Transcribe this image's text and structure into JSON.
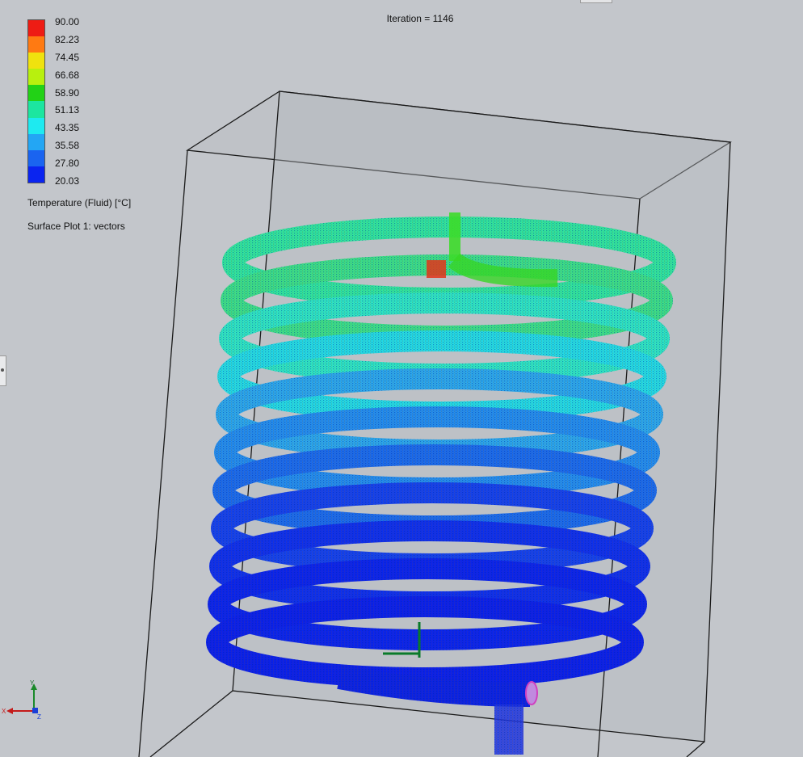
{
  "viewport": {
    "name": "3D graphics area"
  },
  "iteration_label": "Iteration = 1146",
  "legend": {
    "title": "Temperature (Fluid) [°C]",
    "plot_name": "Surface Plot 1: vectors",
    "ticks": [
      "90.00",
      "82.23",
      "74.45",
      "66.68",
      "58.90",
      "51.13",
      "43.35",
      "35.58",
      "27.80",
      "20.03"
    ],
    "colors": [
      "#ee1c14",
      "#ff7a12",
      "#f0e20e",
      "#b8f00e",
      "#22d216",
      "#1ce6a0",
      "#1eeaf0",
      "#23a6f4",
      "#1a64f0",
      "#0a24f0"
    ]
  },
  "triad": {
    "x_label": "X",
    "y_label": "Y",
    "z_label": "Z"
  }
}
